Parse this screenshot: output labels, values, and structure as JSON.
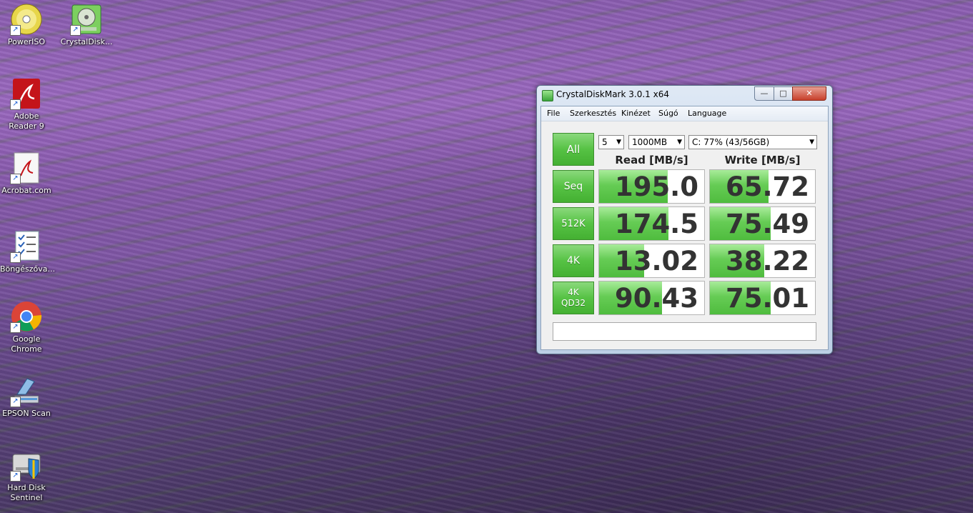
{
  "desktop": {
    "icons": [
      {
        "label": "PowerISO",
        "icon": "disc-icon"
      },
      {
        "label": "CrystalDisk...",
        "icon": "crystaldisk-icon"
      },
      {
        "label": "Adobe Reader 9",
        "icon": "adobe-reader-icon"
      },
      {
        "label": "Acrobat.com",
        "icon": "acrobat-icon"
      },
      {
        "label": "Böngészőva...",
        "icon": "checklist-icon"
      },
      {
        "label": "Google Chrome",
        "icon": "chrome-icon"
      },
      {
        "label": "EPSON Scan",
        "icon": "scanner-icon"
      },
      {
        "label": "Hard Disk Sentinel",
        "icon": "hdd-shield-icon"
      }
    ]
  },
  "window": {
    "title": "CrystalDiskMark 3.0.1 x64",
    "buttons": {
      "minimize": "—",
      "maximize": "□",
      "close": "✕"
    },
    "menu": [
      "File",
      "Szerkesztés",
      "Kinézet",
      "Súgó",
      "Language"
    ],
    "controls": {
      "runs": "5",
      "size": "1000MB",
      "drive": "C: 77% (43/56GB)",
      "all_label": "All"
    },
    "headers": {
      "read": "Read [MB/s]",
      "write": "Write [MB/s]"
    },
    "rows": [
      {
        "label": "Seq",
        "read": "195.0",
        "write": "65.72",
        "read_fill": 0.65,
        "write_fill": 0.56
      },
      {
        "label": "512K",
        "read": "174.5",
        "write": "75.49",
        "read_fill": 0.66,
        "write_fill": 0.58
      },
      {
        "label": "4K",
        "read": "13.02",
        "write": "38.22",
        "read_fill": 0.43,
        "write_fill": 0.52
      },
      {
        "label": "4K\nQD32",
        "read": "90.43",
        "write": "75.01",
        "read_fill": 0.6,
        "write_fill": 0.58
      }
    ],
    "status": ""
  },
  "colors": {
    "accent_green": "#56c244",
    "title_bg": "#c9d8ea",
    "close_red": "#c7402b"
  }
}
